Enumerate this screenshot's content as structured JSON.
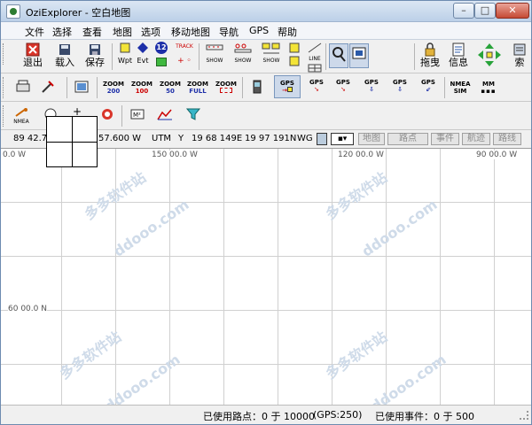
{
  "window": {
    "title": "OziExplorer - 空白地图"
  },
  "menu": [
    "文件",
    "选择",
    "查看",
    "地图",
    "选项",
    "移动地图",
    "导航",
    "GPS",
    "帮助"
  ],
  "toolbar1": {
    "exit": "退出",
    "load": "载入",
    "save": "保存",
    "wpt": "Wpt",
    "evt": "Evt",
    "track_num": "12",
    "track": "TRACK",
    "show": "SHOW",
    "line": "LINE",
    "zoom_value": "100",
    "drag": "拖曳",
    "info": "信息",
    "index": "索"
  },
  "toolbar2": {
    "zoom_labels": [
      {
        "top": "ZOOM",
        "bottom": "200"
      },
      {
        "top": "ZOOM",
        "bottom": "100"
      },
      {
        "top": "ZOOM",
        "bottom": "50"
      },
      {
        "top": "ZOOM",
        "bottom": "FULL"
      },
      {
        "top": "ZOOM",
        "bottom": ""
      }
    ],
    "gps_labels": [
      "GPS",
      "GPS",
      "GPS",
      "GPS",
      "GPS",
      "GPS"
    ],
    "nmea_sim": [
      "NMEA",
      "SIM"
    ],
    "mm": "MM"
  },
  "toolbar3": {
    "nmea": "NMEA"
  },
  "positionbar": {
    "lat": "89 42.72",
    "lon": "57.600 W",
    "grid": "UTM",
    "zone": "Y",
    "easting": "19 68 149E",
    "northing": "19 97 191N",
    "datum": "WG",
    "buttons": [
      "地图",
      "路点",
      "事件",
      "航迹",
      "路线"
    ]
  },
  "map": {
    "top_labels": [
      "0.0 W",
      "150 00.0 W",
      "120 00.0 W",
      "90 00.0 W"
    ],
    "left_label": "60 00.0 N",
    "watermarks": [
      "多多软件站",
      "ddooo.com",
      "多多软件站",
      "ddooo.com",
      "多多软件站",
      "ddooo.com",
      "多多软件站",
      "ddooo.com"
    ]
  },
  "status": {
    "waypoints": "已使用路点：0 于 10000",
    "gps": "(GPS:250)",
    "events": "已使用事件：0 于 500"
  },
  "colors": {
    "accent": "#2b5aa8",
    "close": "#c54a35",
    "grid": "#d0d0d0"
  }
}
